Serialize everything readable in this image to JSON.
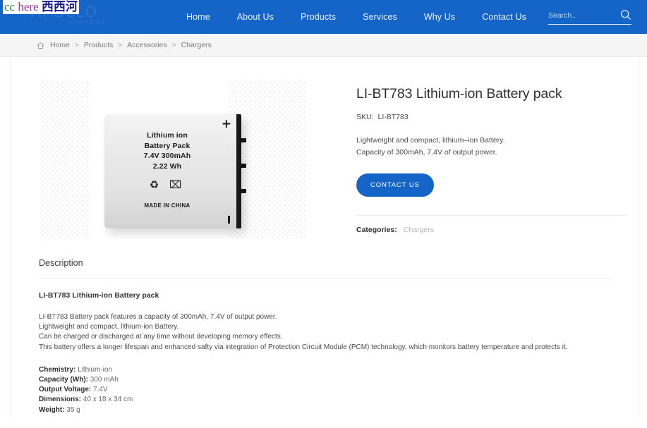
{
  "watermark": {
    "part1": "cc",
    "part2": "here",
    "part3": "西西河"
  },
  "header": {
    "logo_main": "APOLLO",
    "logo_sub": "SYSTEMS",
    "nav": [
      {
        "label": "Home"
      },
      {
        "label": "About Us"
      },
      {
        "label": "Products"
      },
      {
        "label": "Services"
      },
      {
        "label": "Why Us"
      },
      {
        "label": "Contact Us"
      }
    ],
    "search": {
      "placeholder": "Search..",
      "value": "",
      "icon": "search-icon"
    },
    "background_color": "#1565c8"
  },
  "breadcrumb": {
    "home_icon": "home-icon",
    "items": [
      {
        "label": "Home"
      },
      {
        "label": "Products"
      },
      {
        "label": "Accessories"
      },
      {
        "label": "Chargers"
      }
    ],
    "separator": ">"
  },
  "product": {
    "title": "LI-BT783 Lithium-ion Battery pack",
    "sku_label": "SKU:",
    "sku_value": "LI-BT783",
    "short_description": [
      "Lightweight and compact, lithium–ion Battery.",
      "Capacity of 300mAh, 7.4V of output power."
    ],
    "contact_button": "CONTACT US",
    "categories_label": "Categories:",
    "categories_value": "Chargers",
    "image": {
      "label_lines": [
        "Lithium ion",
        "Battery Pack",
        "7.4V 300mAh",
        "2.22 Wh"
      ],
      "symbols": "♻ ⌧",
      "origin": "MADE IN CHINA",
      "plus_terminal": "+",
      "alt": "silver lithium-ion battery pack"
    }
  },
  "description": {
    "heading": "Description",
    "subtitle": "LI-BT783 Lithium-ion Battery pack",
    "paragraph_lines": [
      "LI-BT783 Battery pack features a capacity of 300mAh, 7.4V of output power.",
      "Lightweight and compact, lithium-ion Battery.",
      "Can be charged or discharged at any time without developing memory effects.",
      "This battery offers a longer lifespan and enhanced safty via integration of Protection Circuit Module (PCM) technology, which monitors battery temperature and protects it."
    ],
    "specs": [
      {
        "key": "Chemistry:",
        "value": "Lithium-ion"
      },
      {
        "key": "Capacity (Wh):",
        "value": "300 mAh"
      },
      {
        "key": "Output Voltage:",
        "value": "7.4V"
      },
      {
        "key": "Dimensions:",
        "value": "40 x 18 x 34 cm"
      },
      {
        "key": "Weight:",
        "value": "35 g"
      }
    ]
  },
  "colors": {
    "brand_blue": "#1565c8",
    "breadcrumb_bg": "#f5f5f5",
    "divider": "#ececec"
  }
}
